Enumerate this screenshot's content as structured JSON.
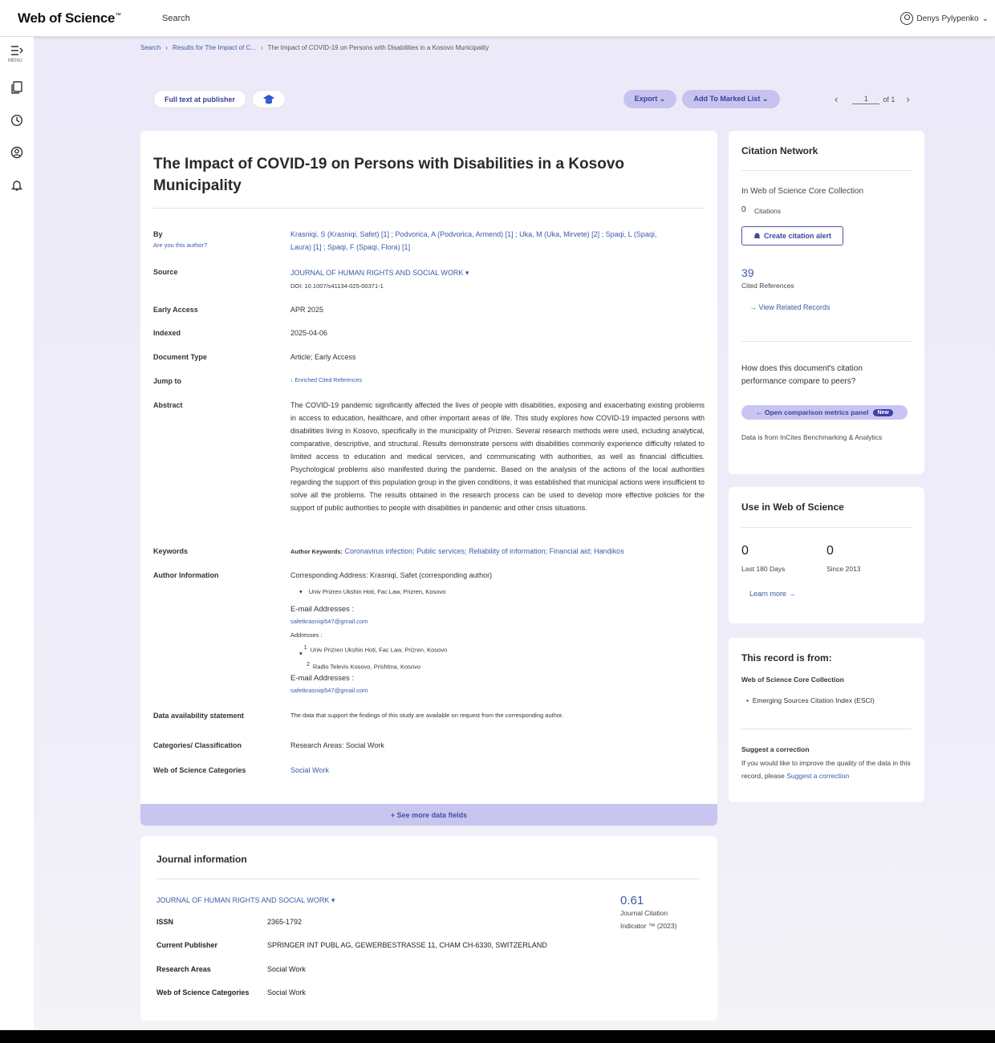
{
  "header": {
    "logo": "Web of Science",
    "logo_tm": "™",
    "search_label": "Search",
    "user_name": "Denys Pylypenko",
    "user_chevron": "⌄"
  },
  "sidebar": {
    "menu_label": "MENU",
    "items": [
      "menu-icon",
      "marked-list-icon",
      "history-icon",
      "profile-icon",
      "alerts-icon"
    ]
  },
  "breadcrumb": {
    "items": [
      "Search",
      "Results for The Impact of C...",
      "The Impact of COVID-19 on Persons with Disabilities in a Kosovo Municipality"
    ],
    "separator": "›"
  },
  "toolbar": {
    "full_text": "Full text at publisher",
    "export": "Export ⌄",
    "add_marked": "Add To Marked List ⌄",
    "page_current": "1",
    "page_of": "of 1",
    "prev": "‹",
    "next": "›"
  },
  "record": {
    "title": "The Impact of COVID-19 on Persons with Disabilities in a Kosovo Municipality",
    "labels": {
      "by": "By",
      "are_you": "Are you this author?",
      "source": "Source",
      "early_access": "Early Access",
      "indexed": "Indexed",
      "doc_type": "Document Type",
      "jump_to": "Jump to",
      "abstract": "Abstract",
      "keywords": "Keywords",
      "author_info": "Author Information",
      "data_avail": "Data availability statement",
      "categories": "Categories/ Classification",
      "wos_categories": "Web of Science Categories"
    },
    "authors_line1": "Krasniqi, S (Krasniqi, Safet) [1] ; Podvorica, A (Podvorica, Armend) [1] ; Uka, M (Uka, Mirvete) [2] ; Spaqi, L (Spaqi,",
    "authors_line2": "Laura) [1] ; Spaqi, F (Spaqi, Flora) [1]",
    "source": "JOURNAL OF HUMAN RIGHTS AND SOCIAL WORK ▾",
    "doi": "DOI: 10.1007/s41134-025-00371-1",
    "early_access": "APR 2025",
    "indexed": "2025-04-06",
    "doc_type": "Article; Early Access",
    "jump_to": "↓ Enriched Cited References",
    "abstract": "The COVID-19 pandemic significantly affected the lives of people with disabilities, exposing and exacerbating existing problems in access to education, healthcare, and other important areas of life. This study explores how COVID-19 impacted persons with disabilities living in Kosovo, specifically in the municipality of Prizren. Several research methods were used, including analytical, comparative, descriptive, and structural. Results demonstrate persons with disabilities commonly experience difficulty related to limited access to education and medical services, and communicating with authorities, as well as financial difficulties. Psychological problems also manifested during the pandemic. Based on the analysis of the actions of the local authorities regarding the support of this population group in the given conditions, it was established that municipal actions were insufficient to solve all the problems. The results obtained in the research process can be used to develop more effective policies for the support of public authorities to people with disabilities in pandemic and other crisis situations.",
    "keywords_prefix": "Author Keywords:",
    "keywords": "Coronavirus infection; Public services; Reliability of information; Financial aid; Handikos",
    "corresponding": "Corresponding Address: Krasniqi, Safet (corresponding author)",
    "corr_addr": "Univ Prizren Ukshin Hoti, Fac Law, Prizren, Kosovo",
    "email_label": "E-mail Addresses :",
    "email": "safetkrasniqi547@gmail.com",
    "addresses_label": "Addresses :",
    "addr1_num": "1",
    "addr1": "Univ Prizren Ukshin Hoti, Fac Law, Prizren, Kosovo",
    "addr2_num": "2",
    "addr2": "Radio Televis Kosovo, Prishtina, Kosovo",
    "email_label2": "E-mail Addresses :",
    "email2": "safetkrasniqi547@gmail.com",
    "data_avail": "The data that support the findings of this study are available on request from the corresponding author.",
    "categories": "Research Areas: Social Work",
    "wos_categories": "Social Work",
    "see_more": "+ See more data fields"
  },
  "journal": {
    "heading": "Journal information",
    "name": "JOURNAL OF HUMAN RIGHTS AND SOCIAL WORK ▾",
    "issn_label": "ISSN",
    "issn": "2365-1792",
    "publisher_label": "Current Publisher",
    "publisher": "SPRINGER INT PUBL AG, GEWERBESTRASSE 11, CHAM CH-6330, SWITZERLAND",
    "areas_label": "Research Areas",
    "areas": "Social Work",
    "wos_label": "Web of Science Categories",
    "wos": "Social Work",
    "jci_value": "0.61",
    "jci_label1": "Journal Citation",
    "jci_label2": "Indicator ™ (2023)"
  },
  "citation_network": {
    "heading": "Citation Network",
    "collection": "In Web of Science Core Collection",
    "citations_count": "0",
    "citations_label": "Citations",
    "create_alert": "Create citation alert",
    "cited_refs_count": "39",
    "cited_refs_label": "Cited References",
    "view_related": "→ View Related Records",
    "compare_question": "How does this document's citation performance compare to peers?",
    "open_panel": "← Open comparison metrics panel",
    "new_badge": "New",
    "data_source": "Data is from InCites Benchmarking & Analytics"
  },
  "usage": {
    "heading": "Use in Web of Science",
    "last180_count": "0",
    "last180_label": "Last 180 Days",
    "since2013_count": "0",
    "since2013_label": "Since 2013",
    "learn_more": "Learn more →"
  },
  "record_from": {
    "heading": "This record is from:",
    "collection": "Web of Science Core Collection",
    "index": "Emerging Sources Citation Index (ESCI)",
    "suggest_heading": "Suggest a correction",
    "suggest_text": "If you would like to improve the quality of the data in this record, please",
    "suggest_link": "Suggest a correction"
  }
}
